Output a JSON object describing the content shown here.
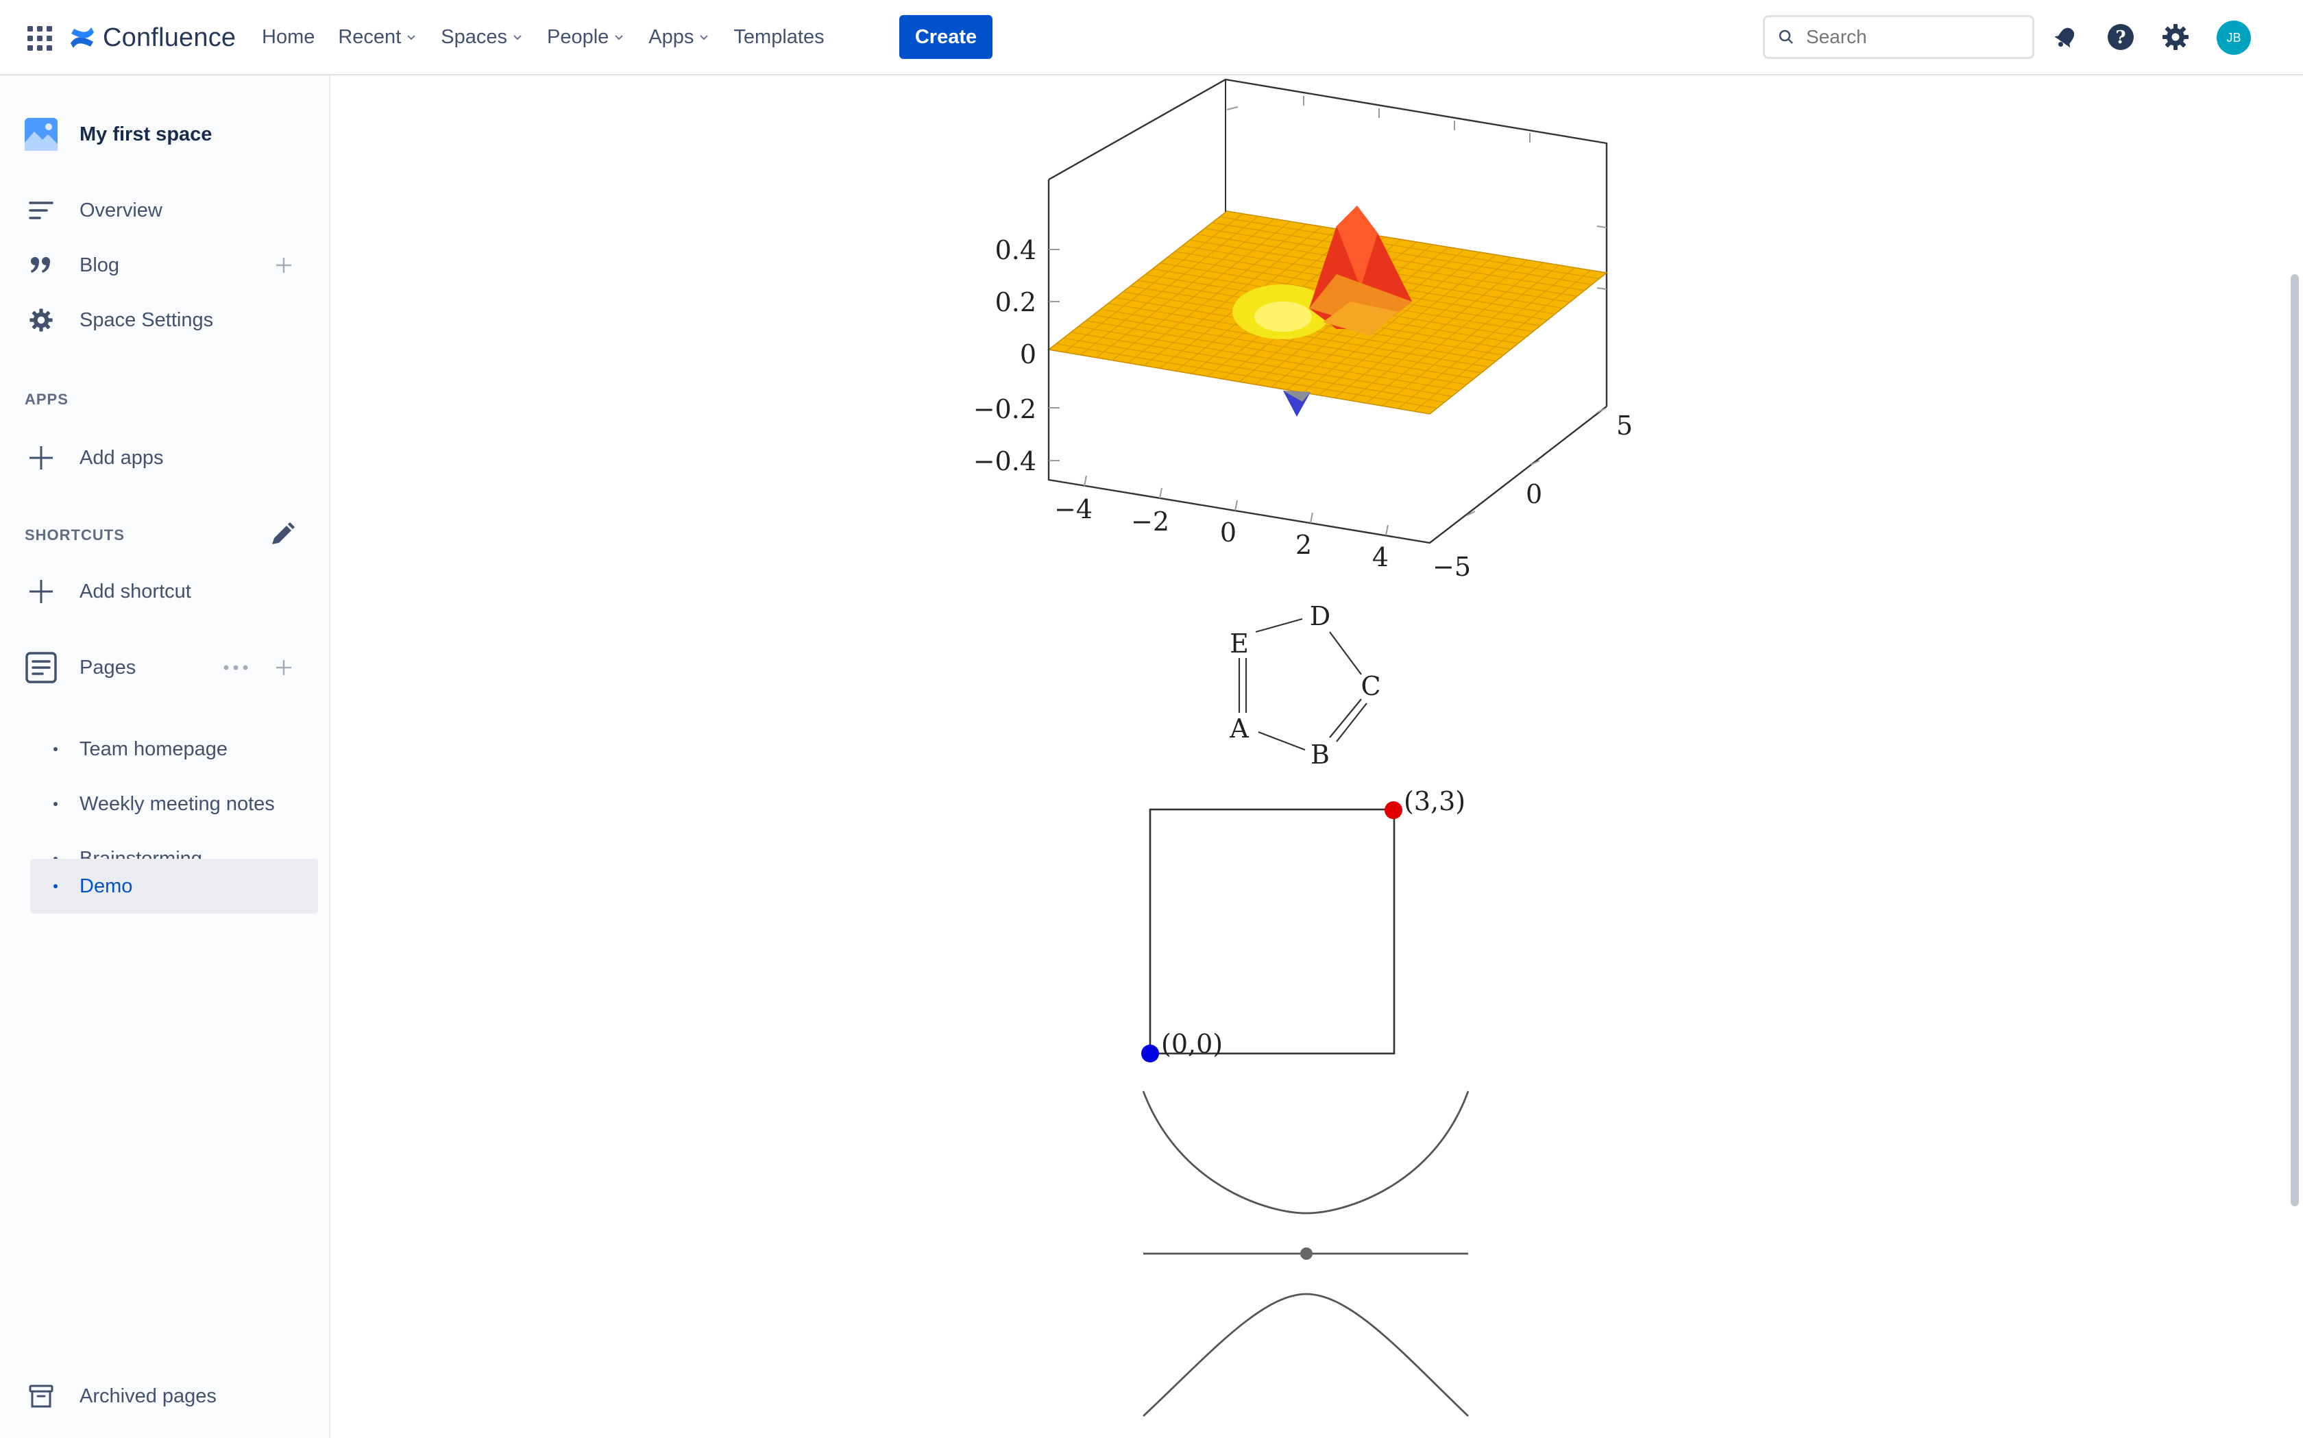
{
  "topbar": {
    "logo_text": "Confluence",
    "nav": [
      {
        "label": "Home",
        "dropdown": false
      },
      {
        "label": "Recent",
        "dropdown": true
      },
      {
        "label": "Spaces",
        "dropdown": true
      },
      {
        "label": "People",
        "dropdown": true
      },
      {
        "label": "Apps",
        "dropdown": true
      },
      {
        "label": "Templates",
        "dropdown": false
      }
    ],
    "create_label": "Create",
    "search_placeholder": "Search",
    "avatar_initials": "JB",
    "accent_color": "#0052cc"
  },
  "sidebar": {
    "space_name": "My first space",
    "items": {
      "overview": "Overview",
      "blog": "Blog",
      "space_settings": "Space Settings"
    },
    "apps_heading": "APPS",
    "add_apps": "Add apps",
    "shortcuts_heading": "SHORTCUTS",
    "add_shortcut": "Add shortcut",
    "pages_heading": "Pages",
    "pages": [
      {
        "label": "Team homepage",
        "active": false
      },
      {
        "label": "Weekly meeting notes",
        "active": false
      },
      {
        "label": "Brainstorming",
        "active": false
      },
      {
        "label": "Demo",
        "active": true
      }
    ],
    "archived": "Archived pages"
  },
  "figures": {
    "surface_plot": {
      "z_ticks": [
        "0.4",
        "0.2",
        "0",
        "−0.2",
        "−0.4"
      ],
      "x_ticks": [
        "−4",
        "−2",
        "0",
        "2",
        "4"
      ],
      "y_ticks": [
        "−5",
        "0",
        "5"
      ],
      "surface_color": "#f7b500",
      "peak_color": "#e8341a",
      "trough_color": "#f5e61a",
      "spike_color": "#3a3fd0"
    },
    "graph": {
      "nodes": [
        "A",
        "B",
        "C",
        "D",
        "E"
      ]
    },
    "square": {
      "top_label": "(3,3)",
      "bottom_label": "(0,0)",
      "top_color": "#e00000",
      "bottom_color": "#0000e0"
    }
  }
}
